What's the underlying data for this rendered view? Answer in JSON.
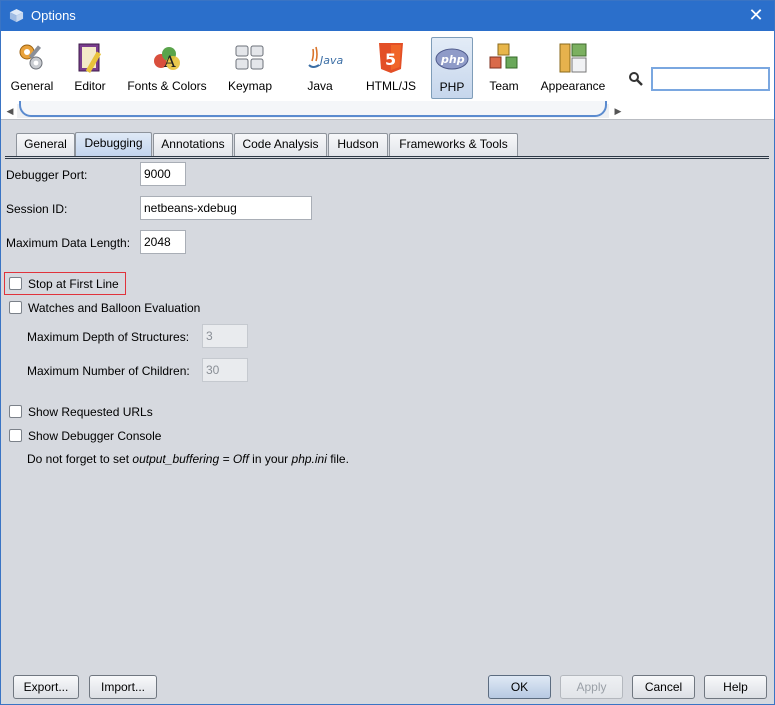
{
  "window": {
    "title": "Options",
    "close_glyph": "✕"
  },
  "categories": [
    {
      "label": "General",
      "icon": "gears-icon"
    },
    {
      "label": "Editor",
      "icon": "editor-icon"
    },
    {
      "label": "Fonts & Colors",
      "icon": "fonts-colors-icon"
    },
    {
      "label": "Keymap",
      "icon": "keymap-icon"
    },
    {
      "label": "Java",
      "icon": "java-icon"
    },
    {
      "label": "HTML/JS",
      "icon": "html5-icon"
    },
    {
      "label": "PHP",
      "icon": "php-icon",
      "selected": true
    },
    {
      "label": "Team",
      "icon": "team-icon"
    },
    {
      "label": "Appearance",
      "icon": "appearance-icon"
    }
  ],
  "search": {
    "value": "",
    "placeholder": ""
  },
  "tabs": [
    {
      "label": "General"
    },
    {
      "label": "Debugging",
      "active": true
    },
    {
      "label": "Annotations"
    },
    {
      "label": "Code Analysis"
    },
    {
      "label": "Hudson"
    },
    {
      "label": "Frameworks & Tools"
    }
  ],
  "form": {
    "debugger_port": {
      "label": "Debugger Port:",
      "value": "9000"
    },
    "session_id": {
      "label": "Session ID:",
      "value": "netbeans-xdebug"
    },
    "max_data_length": {
      "label": "Maximum Data Length:",
      "value": "2048"
    },
    "stop_first_line": {
      "label": "Stop at First Line",
      "checked": false
    },
    "watches": {
      "label": "Watches and Balloon Evaluation",
      "checked": false
    },
    "max_depth": {
      "label": "Maximum Depth of Structures:",
      "value": "3"
    },
    "max_children": {
      "label": "Maximum Number of Children:",
      "value": "30"
    },
    "show_urls": {
      "label": "Show Requested URLs",
      "checked": false
    },
    "show_console": {
      "label": "Show Debugger Console",
      "checked": false
    },
    "note": {
      "prefix": "Do not forget to set ",
      "setting": "output_buffering = Off",
      "middle": " in your ",
      "file": "php.ini",
      "suffix": " file."
    }
  },
  "buttons": {
    "export": "Export...",
    "import": "Import...",
    "ok": "OK",
    "apply": "Apply",
    "cancel": "Cancel",
    "help": "Help"
  },
  "colors": {
    "titlebar": "#2b6fcb",
    "focus": "#e0333c",
    "selected_tab": "#c3d5ee"
  }
}
